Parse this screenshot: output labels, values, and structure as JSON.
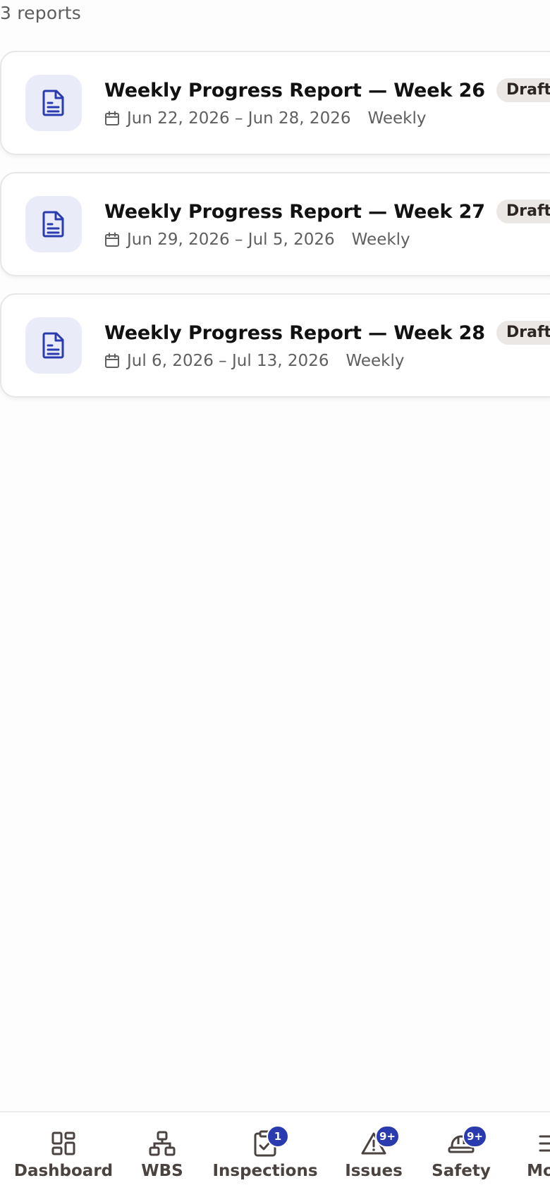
{
  "summary": {
    "count_text": "3 reports"
  },
  "reports": [
    {
      "title": "Weekly Progress Report — Week 26",
      "status": "Draft",
      "date_range": "Jun 22, 2026 – Jun 28, 2026",
      "frequency": "Weekly"
    },
    {
      "title": "Weekly Progress Report — Week 27",
      "status": "Draft",
      "date_range": "Jun 29, 2026 – Jul 5, 2026",
      "frequency": "Weekly"
    },
    {
      "title": "Weekly Progress Report — Week 28",
      "status": "Draft",
      "date_range": "Jul 6, 2026 – Jul 13, 2026",
      "frequency": "Weekly"
    }
  ],
  "nav": {
    "items": [
      {
        "label": "Dashboard",
        "icon": "dashboard-icon",
        "badge": ""
      },
      {
        "label": "WBS",
        "icon": "hierarchy-icon",
        "badge": ""
      },
      {
        "label": "Inspections",
        "icon": "clipboard-check-icon",
        "badge": "1"
      },
      {
        "label": "Issues",
        "icon": "warning-triangle-icon",
        "badge": "9+"
      },
      {
        "label": "Safety",
        "icon": "hard-hat-icon",
        "badge": "9+"
      },
      {
        "label": "More",
        "icon": "menu-icon",
        "badge": ""
      }
    ]
  },
  "colors": {
    "accent": "#2a3bb0",
    "badge_bg": "#ebe7e4",
    "doc_tile_bg": "#e9ecf8"
  }
}
